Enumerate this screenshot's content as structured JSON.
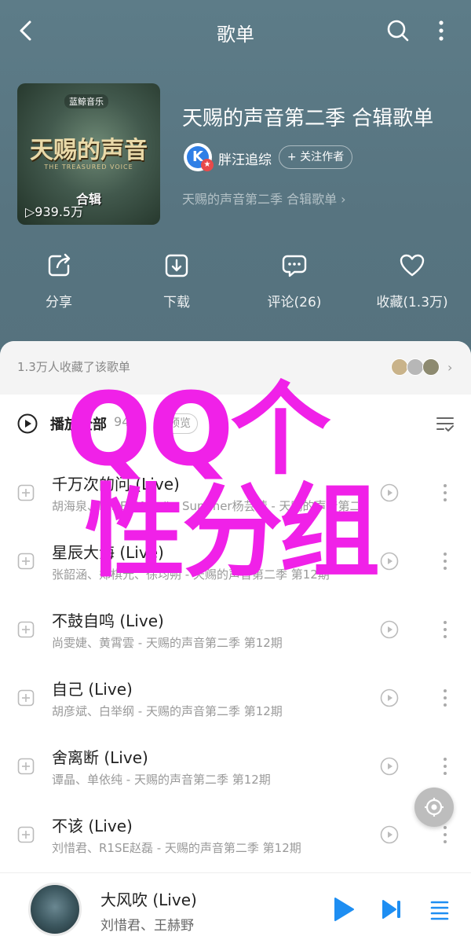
{
  "topbar": {
    "title": "歌单"
  },
  "playlist": {
    "cover_brand": "蓝鲸音乐",
    "cover_logo": "天赐的声音",
    "cover_sub": "THE TREASURED VOICE",
    "cover_kind": "合辑",
    "cover_plays": "▷939.5万",
    "title": "天赐的声音第二季 合辑歌单",
    "creator": "胖汪追综",
    "follow_label": "+ 关注作者",
    "description": "天赐的声音第二季 合辑歌单 ›"
  },
  "actions": [
    {
      "label": "分享",
      "icon": "share-icon"
    },
    {
      "label": "下载",
      "icon": "download-icon"
    },
    {
      "label": "评论(26)",
      "icon": "comment-icon"
    },
    {
      "label": "收藏(1.3万)",
      "icon": "heart-icon"
    }
  ],
  "collect": {
    "text": "1.3万人收藏了该歌单"
  },
  "play_all": {
    "label": "播放全部",
    "count": "94",
    "tag": "预览"
  },
  "songs": [
    {
      "name": "千万次的问 (Live)",
      "meta": "胡海泉、NINE ONE #、Summer杨芸晴 - 天赐的声音第二季 第12期"
    },
    {
      "name": "星辰大海 (Live)",
      "meta": "张韶涵、郑棋元、徐均朔 - 天赐的声音第二季 第12期"
    },
    {
      "name": "不鼓自鸣 (Live)",
      "meta": "尚雯婕、黄霄雲 - 天赐的声音第二季 第12期"
    },
    {
      "name": "自己 (Live)",
      "meta": "胡彦斌、白举纲 - 天赐的声音第二季 第12期"
    },
    {
      "name": "舍离断 (Live)",
      "meta": "谭晶、单依纯 - 天赐的声音第二季 第12期"
    },
    {
      "name": "不该 (Live)",
      "meta": "刘惜君、R1SE赵磊 - 天赐的声音第二季 第12期"
    }
  ],
  "watermark": {
    "line1": "QQ个",
    "line2": "性分组"
  },
  "player": {
    "title": "大风吹 (Live)",
    "artist": "刘惜君、王赫野"
  },
  "colors": {
    "header_bg": "#5b7a86",
    "accent_blue": "#1e8ef2",
    "watermark": "#f021e8"
  }
}
